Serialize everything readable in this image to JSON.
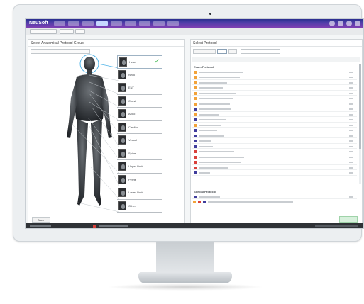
{
  "app": {
    "logo": "NeuSoft"
  },
  "left_panel": {
    "title": "Select Anatomical Protocol Group",
    "back_label": "Back",
    "protocols": [
      {
        "label": "Head",
        "selected": true
      },
      {
        "label": "Neck"
      },
      {
        "label": "ENT"
      },
      {
        "label": "Chest"
      },
      {
        "label": "Abdo"
      },
      {
        "label": "Cardiac"
      },
      {
        "label": "Vessel"
      },
      {
        "label": "Spine"
      },
      {
        "label": "Upper Limb"
      },
      {
        "label": "Pelvis"
      },
      {
        "label": "Lower Limb"
      },
      {
        "label": "Other"
      }
    ]
  },
  "right_panel": {
    "title": "Select Protocol",
    "groups": [
      "Exam Protocol",
      "Special Protocol"
    ]
  },
  "colors": {
    "accent": "#4f3ea8",
    "orange": "#f2a33a",
    "purple": "#3f3c9c",
    "red": "#d9413b",
    "check": "#3bb54a"
  }
}
